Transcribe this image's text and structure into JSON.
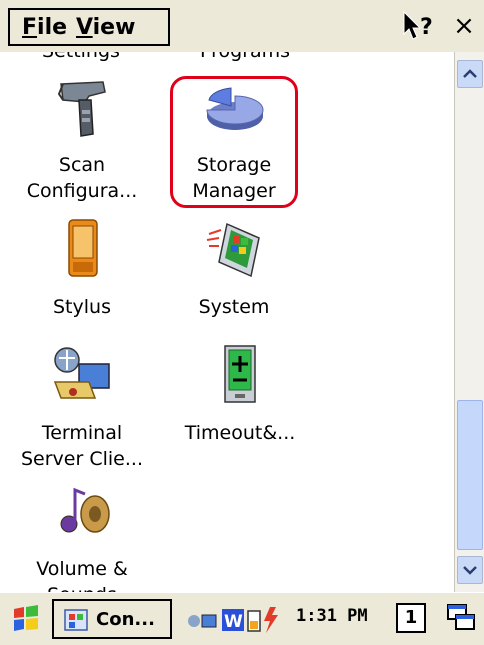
{
  "menubar": {
    "file_label": "File",
    "view_label": "View",
    "close_label": "×"
  },
  "items": {
    "scan": {
      "line1": "Scan",
      "line2": "Configura..."
    },
    "storage": {
      "line1": "Storage",
      "line2": "Manager"
    },
    "stylus": {
      "line1": "Stylus"
    },
    "system": {
      "line1": "System"
    },
    "terminal": {
      "line1": "Terminal",
      "line2": "Server Clie..."
    },
    "timeout": {
      "line1": "Timeout&..."
    },
    "volume": {
      "line1": "Volume &",
      "line2": "Sounds"
    },
    "settings_partial": "Settings",
    "programs_partial": "Programs"
  },
  "taskbar": {
    "task_label": "Con...",
    "clock": "1:31 PM",
    "input_indicator": "1"
  },
  "colors": {
    "highlight": "#e0001a",
    "chrome": "#ece9d8"
  }
}
